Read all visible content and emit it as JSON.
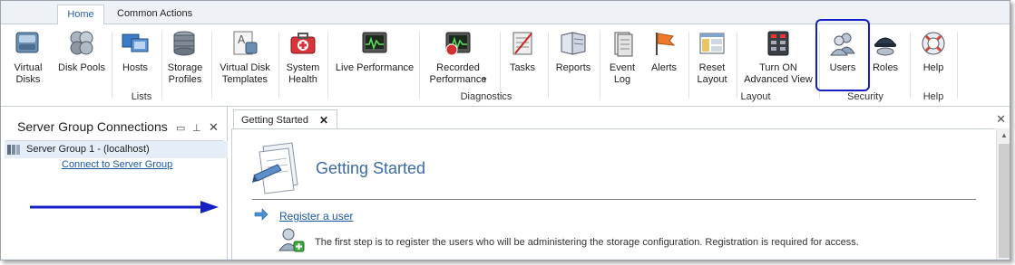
{
  "tabs": [
    {
      "label": "Home",
      "active": true
    },
    {
      "label": "Common Actions",
      "active": false
    }
  ],
  "ribbon": {
    "lists": {
      "group_label": "Lists",
      "virtual_disks": "Virtual Disks",
      "disk_pools": "Disk Pools",
      "hosts": "Hosts",
      "storage_profiles": "Storage Profiles",
      "virtual_disk_templates": "Virtual Disk Templates"
    },
    "diagnostics": {
      "group_label": "Diagnostics",
      "system_health": "System Health",
      "live_performance": "Live Performance",
      "recorded_performance": "Recorded Performance",
      "tasks": "Tasks",
      "reports": "Reports",
      "event_log": "Event Log",
      "alerts": "Alerts"
    },
    "layout": {
      "group_label": "Layout",
      "reset_layout": "Reset Layout",
      "advanced_view": "Turn ON Advanced View"
    },
    "security": {
      "group_label": "Security",
      "users": "Users",
      "roles": "Roles"
    },
    "help": {
      "group_label": "Help",
      "help": "Help"
    }
  },
  "left_panel": {
    "title": "Server Group Connections",
    "tree_item": "Server Group 1 - (localhost)",
    "connect_link": "Connect to Server Group"
  },
  "document": {
    "tab_label": "Getting Started",
    "title": "Getting Started",
    "register_link": "Register a user",
    "register_desc": "The first step is to register the users who will be administering the storage configuration.  Registration is required for access."
  },
  "colors": {
    "highlight": "#1520c4",
    "link": "#1a56a8",
    "title": "#3b6ba5"
  }
}
